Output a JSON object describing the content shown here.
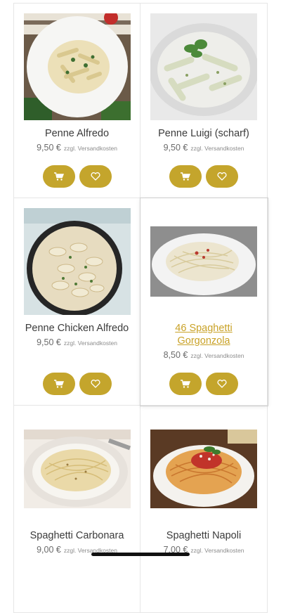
{
  "products": [
    {
      "name": "Penne Alfredo",
      "price": "9,50 €",
      "shipping": "zzgl. Versandkosten",
      "link": false,
      "image": "penne-alfredo-plate"
    },
    {
      "name": "Penne Luigi (scharf)",
      "price": "9,50 €",
      "shipping": "zzgl. Versandkosten",
      "link": false,
      "image": "penne-luigi-bowl"
    },
    {
      "name": "Penne Chicken Alfredo",
      "price": "9,50 €",
      "shipping": "zzgl. Versandkosten",
      "link": false,
      "image": "penne-chicken-pan"
    },
    {
      "name": "46 Spaghetti Gorgonzola",
      "price": "8,50 €",
      "shipping": "zzgl. Versandkosten",
      "link": true,
      "image": "spaghetti-gorgonzola-plate"
    },
    {
      "name": "Spaghetti Carbonara",
      "price": "9,00 €",
      "shipping": "zzgl. Versandkosten",
      "link": false,
      "image": "spaghetti-carbonara-plate"
    },
    {
      "name": "Spaghetti Napoli",
      "price": "7,00 €",
      "shipping": "zzgl. Versandkosten",
      "link": false,
      "image": "spaghetti-napoli-plate"
    }
  ],
  "icons": {
    "cart": "cart-icon",
    "wishlist": "heart-icon"
  },
  "colors": {
    "button": "#c4a52c",
    "link": "#c9a227"
  }
}
